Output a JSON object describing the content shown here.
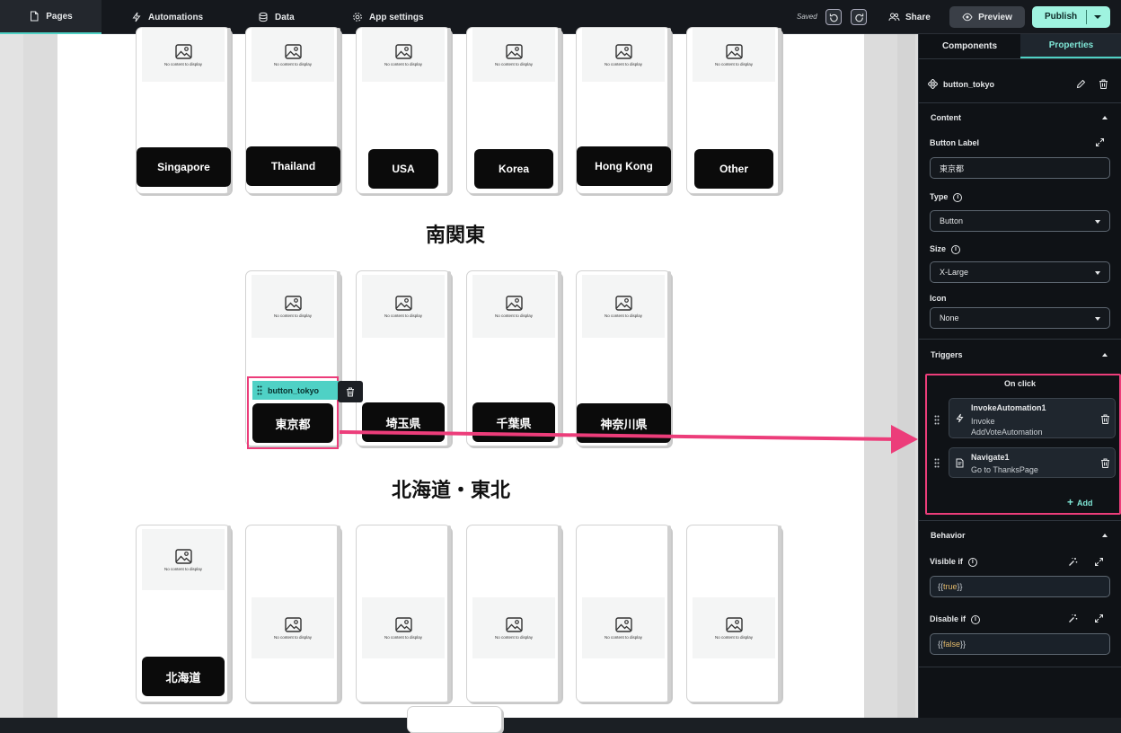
{
  "topbar": {
    "tabs": [
      {
        "label": "Pages",
        "icon": "page-icon"
      },
      {
        "label": "Automations",
        "icon": "lightning-icon"
      },
      {
        "label": "Data",
        "icon": "database-icon"
      },
      {
        "label": "App settings",
        "icon": "gear-icon"
      }
    ],
    "saved": "Saved",
    "share": "Share",
    "preview": "Preview",
    "publish": "Publish"
  },
  "canvas": {
    "no_content": "No content to display",
    "row1_buttons": [
      "Singapore",
      "Thailand",
      "USA",
      "Korea",
      "Hong Kong",
      "Other"
    ],
    "heading_kanto": "南関東",
    "row2_buttons": [
      "東京都",
      "埼玉県",
      "千葉県",
      "神奈川県"
    ],
    "heading_hokkaido": "北海道・東北",
    "row3_buttons": [
      "北海道"
    ],
    "selected_tag": "button_tokyo"
  },
  "panel": {
    "tabs": [
      "Components",
      "Properties"
    ],
    "component_name": "button_tokyo",
    "content_header": "Content",
    "button_label_title": "Button Label",
    "button_label_value": "東京都",
    "type_title": "Type",
    "type_value": "Button",
    "size_title": "Size",
    "size_value": "X-Large",
    "icon_title": "Icon",
    "icon_value": "None",
    "triggers_header": "Triggers",
    "on_click": "On click",
    "actions": [
      {
        "title": "InvokeAutomation1",
        "desc1": "Invoke",
        "desc2": "AddVoteAutomation"
      },
      {
        "title": "Navigate1",
        "desc1": "Go to ThanksPage",
        "desc2": ""
      }
    ],
    "add": "Add",
    "behavior_header": "Behavior",
    "visible_if": "Visible if",
    "visible_open": "{{",
    "visible_val": "true",
    "visible_close": "}}",
    "disable_if": "Disable if",
    "disable_open": "{{",
    "disable_val": "false",
    "disable_close": "}}"
  },
  "colors": {
    "accent": "#4fd1c5",
    "highlight": "#ec3d7a",
    "publish": "#9ff3e0"
  }
}
